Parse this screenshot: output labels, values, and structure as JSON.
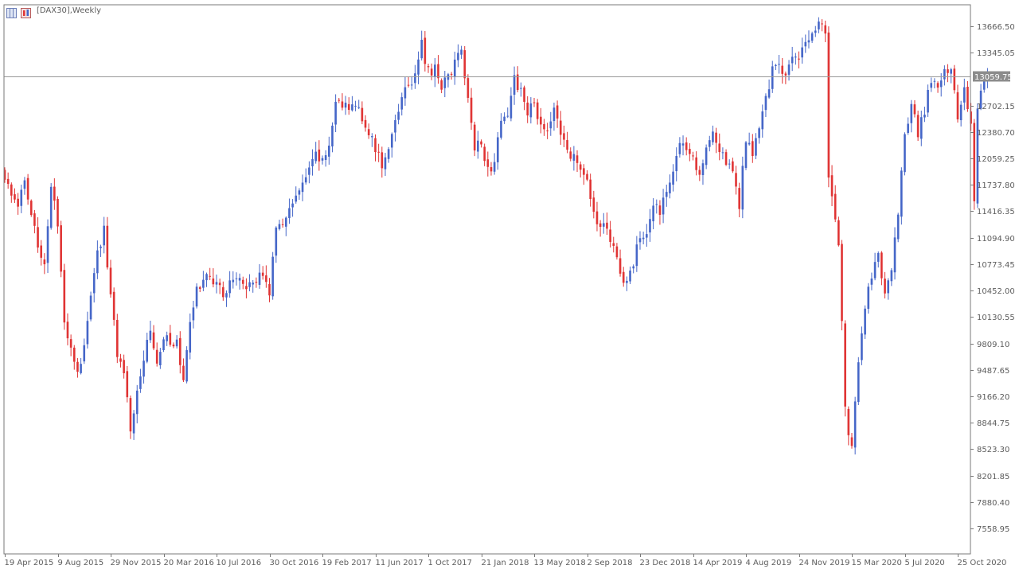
{
  "window": {
    "title": "[DAX30],Weekly"
  },
  "colors": {
    "bull": "#4566c8",
    "bear": "#e03434",
    "grid": "#c8c8c8",
    "axis_text": "#5c5c5c",
    "price_line": "#9a9a9a",
    "price_badge": "#8c8c8c"
  },
  "chart_data": {
    "type": "candlestick",
    "timeframe": "Weekly",
    "symbol": "DAX30",
    "grid": false,
    "ylim": [
      7380,
      13880
    ],
    "current_price": 13059.75,
    "current_price_label": "13059.75",
    "y_ticks": [
      "13666.50",
      "13345.05",
      "12702.15",
      "12380.70",
      "12059.25",
      "11737.80",
      "11416.35",
      "11094.90",
      "10773.45",
      "10452.00",
      "10130.55",
      "9809.10",
      "9487.65",
      "9166.20",
      "8844.75",
      "8523.30",
      "8201.85",
      "7880.40",
      "7558.95"
    ],
    "y_tick_values": [
      13666.5,
      13345.05,
      12702.15,
      12380.7,
      12059.25,
      11737.8,
      11416.35,
      11094.9,
      10773.45,
      10452.0,
      10130.55,
      9809.1,
      9487.65,
      9166.2,
      8844.75,
      8523.3,
      8201.85,
      7880.4,
      7558.95
    ],
    "x_ticks": [
      {
        "label": "19 Apr 2015",
        "index": 0
      },
      {
        "label": "9 Aug 2015",
        "index": 16
      },
      {
        "label": "29 Nov 2015",
        "index": 32
      },
      {
        "label": "20 Mar 2016",
        "index": 48
      },
      {
        "label": "10 Jul 2016",
        "index": 64
      },
      {
        "label": "30 Oct 2016",
        "index": 80
      },
      {
        "label": "19 Feb 2017",
        "index": 96
      },
      {
        "label": "11 Jun 2017",
        "index": 112
      },
      {
        "label": "1 Oct 2017",
        "index": 128
      },
      {
        "label": "21 Jan 2018",
        "index": 144
      },
      {
        "label": "13 May 2018",
        "index": 160
      },
      {
        "label": "2 Sep 2018",
        "index": 176
      },
      {
        "label": "23 Dec 2018",
        "index": 192
      },
      {
        "label": "14 Apr 2019",
        "index": 208
      },
      {
        "label": "4 Aug 2019",
        "index": 224
      },
      {
        "label": "24 Nov 2019",
        "index": 240
      },
      {
        "label": "15 Mar 2020",
        "index": 256
      },
      {
        "label": "5 Jul 2020",
        "index": 272
      },
      {
        "label": "25 Oct 2020",
        "index": 288
      }
    ],
    "close_path": [
      [
        0,
        11800
      ],
      [
        4,
        11500
      ],
      [
        6,
        11750
      ],
      [
        8,
        11300
      ],
      [
        12,
        10800
      ],
      [
        14,
        11700
      ],
      [
        16,
        11250
      ],
      [
        18,
        10000
      ],
      [
        20,
        9800
      ],
      [
        22,
        9400
      ],
      [
        25,
        10050
      ],
      [
        28,
        10900
      ],
      [
        30,
        11200
      ],
      [
        32,
        10400
      ],
      [
        34,
        9700
      ],
      [
        36,
        9500
      ],
      [
        38,
        8750
      ],
      [
        40,
        9300
      ],
      [
        42,
        9650
      ],
      [
        44,
        10000
      ],
      [
        46,
        9550
      ],
      [
        48,
        9900
      ],
      [
        52,
        9800
      ],
      [
        54,
        9300
      ],
      [
        56,
        10100
      ],
      [
        58,
        10450
      ],
      [
        62,
        10650
      ],
      [
        64,
        10550
      ],
      [
        66,
        10400
      ],
      [
        70,
        10650
      ],
      [
        74,
        10500
      ],
      [
        76,
        10550
      ],
      [
        78,
        10700
      ],
      [
        80,
        10450
      ],
      [
        82,
        11150
      ],
      [
        86,
        11450
      ],
      [
        90,
        11700
      ],
      [
        94,
        12100
      ],
      [
        96,
        12000
      ],
      [
        98,
        12250
      ],
      [
        100,
        12750
      ],
      [
        104,
        12650
      ],
      [
        106,
        12750
      ],
      [
        110,
        12400
      ],
      [
        112,
        12150
      ],
      [
        114,
        12000
      ],
      [
        116,
        12200
      ],
      [
        118,
        12450
      ],
      [
        120,
        12850
      ],
      [
        124,
        13050
      ],
      [
        126,
        13450
      ],
      [
        128,
        13100
      ],
      [
        130,
        13150
      ],
      [
        132,
        12950
      ],
      [
        136,
        13200
      ],
      [
        138,
        13400
      ],
      [
        140,
        12750
      ],
      [
        142,
        12200
      ],
      [
        144,
        12300
      ],
      [
        146,
        11900
      ],
      [
        148,
        12050
      ],
      [
        150,
        12450
      ],
      [
        152,
        12600
      ],
      [
        154,
        13050
      ],
      [
        156,
        12850
      ],
      [
        158,
        12600
      ],
      [
        160,
        12750
      ],
      [
        162,
        12400
      ],
      [
        164,
        12450
      ],
      [
        166,
        12700
      ],
      [
        168,
        12350
      ],
      [
        170,
        12100
      ],
      [
        172,
        12150
      ],
      [
        174,
        11850
      ],
      [
        176,
        11800
      ],
      [
        178,
        11400
      ],
      [
        180,
        11250
      ],
      [
        182,
        11150
      ],
      [
        184,
        11000
      ],
      [
        186,
        10650
      ],
      [
        188,
        10500
      ],
      [
        190,
        10800
      ],
      [
        192,
        11100
      ],
      [
        194,
        11150
      ],
      [
        196,
        11500
      ],
      [
        198,
        11400
      ],
      [
        200,
        11700
      ],
      [
        202,
        11950
      ],
      [
        204,
        12300
      ],
      [
        206,
        12200
      ],
      [
        208,
        12150
      ],
      [
        210,
        11800
      ],
      [
        212,
        12250
      ],
      [
        214,
        12400
      ],
      [
        216,
        12150
      ],
      [
        218,
        12000
      ],
      [
        220,
        11850
      ],
      [
        222,
        11500
      ],
      [
        224,
        12300
      ],
      [
        226,
        12150
      ],
      [
        228,
        12450
      ],
      [
        230,
        12750
      ],
      [
        232,
        13150
      ],
      [
        234,
        13200
      ],
      [
        236,
        13100
      ],
      [
        238,
        13250
      ],
      [
        240,
        13250
      ],
      [
        242,
        13450
      ],
      [
        244,
        13600
      ],
      [
        246,
        13750
      ],
      [
        248,
        13650
      ],
      [
        249,
        11900
      ],
      [
        250,
        11550
      ],
      [
        252,
        11050
      ],
      [
        254,
        9000
      ],
      [
        256,
        8500
      ],
      [
        258,
        9600
      ],
      [
        260,
        10250
      ],
      [
        262,
        10600
      ],
      [
        264,
        10900
      ],
      [
        266,
        10400
      ],
      [
        268,
        10650
      ],
      [
        270,
        11400
      ],
      [
        272,
        12300
      ],
      [
        274,
        12700
      ],
      [
        276,
        12350
      ],
      [
        278,
        12650
      ],
      [
        280,
        13000
      ],
      [
        282,
        12900
      ],
      [
        284,
        13150
      ],
      [
        286,
        13100
      ],
      [
        288,
        12600
      ],
      [
        290,
        12900
      ],
      [
        292,
        12450
      ],
      [
        293,
        11550
      ],
      [
        294,
        12600
      ],
      [
        296,
        13059.75
      ]
    ]
  }
}
